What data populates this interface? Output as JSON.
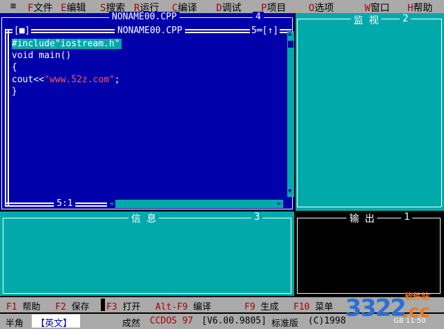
{
  "menu": {
    "system": "≡",
    "items": [
      {
        "key": "F",
        "label": "文件"
      },
      {
        "key": "E",
        "label": "编辑"
      },
      {
        "key": "S",
        "label": "搜索"
      },
      {
        "key": "R",
        "label": "运行"
      },
      {
        "key": "C",
        "label": "编译"
      },
      {
        "key": "D",
        "label": "调试"
      },
      {
        "key": "P",
        "label": "项目"
      },
      {
        "key": "O",
        "label": "选项"
      },
      {
        "key": "W",
        "label": "窗口"
      },
      {
        "key": "H",
        "label": "帮助"
      }
    ]
  },
  "back_window": {
    "title": "NONAME00.CPP",
    "number": "4"
  },
  "editor": {
    "close_box": "[■]",
    "title": "NONAME00.CPP",
    "number_zoom": "5═[↑]",
    "lines": [
      {
        "text": "#include\"iostream.h\""
      },
      {
        "text": "void main()"
      },
      {
        "text": "{"
      },
      {
        "pre": "cout<<",
        "str": "\"www.52z.com\"",
        "post": ";"
      },
      {
        "text": "}"
      }
    ],
    "cursor_pos": "5:1"
  },
  "watch": {
    "title": "监 视",
    "number": "2"
  },
  "message": {
    "title": "信 息",
    "number": "3"
  },
  "output": {
    "title": "输 出",
    "number": "1"
  },
  "fkeys": [
    {
      "key": "F1",
      "label": "帮助"
    },
    {
      "key": "F2",
      "label": "保存"
    },
    {
      "key": "F3",
      "label": "打开"
    },
    {
      "key": "Alt-F9",
      "label": "编译"
    },
    {
      "key": "F9",
      "label": "生成"
    },
    {
      "key": "F10",
      "label": "菜单"
    }
  ],
  "status": {
    "halfwidth": "半角",
    "input_mode": "【英文】",
    "brand_prefix": "成然",
    "brand_name": "CCDOS 97",
    "version": "[V6.00.9805]",
    "edition": "标准版",
    "copyright": "(C)1998"
  },
  "watermark": {
    "number_logo": "3322",
    "suffix": ".cc",
    "site": "软件站",
    "small": "GB 11:50"
  },
  "colors": {
    "editor_bg": "#0000aa",
    "panel_bg": "#00aaaa",
    "bar_bg": "#aaaaaa",
    "hotkey": "#aa0000",
    "string": "#ff5555",
    "selection": "#00aaaa"
  }
}
